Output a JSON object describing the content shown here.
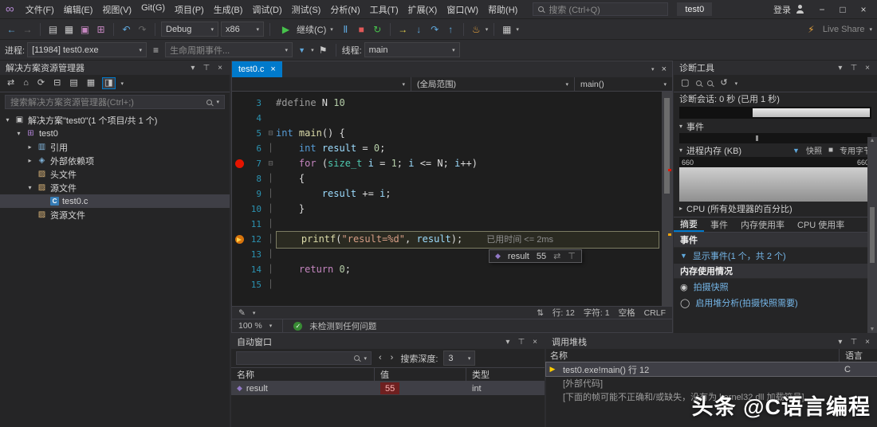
{
  "colors": {
    "accent": "#007acc",
    "breakpoint_red": "#e51400",
    "current_statement_yellow": "#ffd34d",
    "changed_value_red": "#ffb4b4",
    "continue_green": "#47c24c",
    "stop_red": "#e05858",
    "editor_bg": "#1e1e1e",
    "panel_bg": "#252526"
  },
  "icons": {
    "vs_logo": "∞",
    "back": "←",
    "forward": "→",
    "new_file": "▤",
    "open": "▦",
    "save": "▣",
    "save_all": "⊞",
    "undo": "↶",
    "redo": "↷",
    "play": "▶",
    "pause": "Ⅱ",
    "stop": "■",
    "restart": "↻",
    "next_stmt": "→",
    "step_into": "↓",
    "step_over": "↷",
    "step_out": "↑",
    "hot_reload": "♨",
    "chevron": "▾",
    "close": "×",
    "minimize": "−",
    "maximize": "□",
    "pin": "⊤",
    "lightning": "⚡",
    "threads": "≡",
    "funnel": "▼",
    "prev": "‹",
    "next": "›",
    "camera": "◉",
    "circle": "◯",
    "home": "⌂",
    "switch_views": "⇄",
    "refresh": "⟳",
    "collapse_all": "⊟",
    "show_all_files": "▤",
    "properties": "▦",
    "preview": "◨",
    "select_tool": "▢",
    "zoom_reset": "↺",
    "updown": "⇅",
    "diamond": "◆",
    "cur_arrow": "▶",
    "flag": "⚑",
    "check": "✓",
    "broom": "✎",
    "expander_right": "▸"
  },
  "titlebar": {
    "menus": [
      "文件(F)",
      "编辑(E)",
      "视图(V)",
      "Git(G)",
      "项目(P)",
      "生成(B)",
      "调试(D)",
      "测试(S)",
      "分析(N)",
      "工具(T)",
      "扩展(X)",
      "窗口(W)",
      "帮助(H)"
    ],
    "search_placeholder": "搜索 (Ctrl+Q)",
    "solution": "test0",
    "signin": "登录"
  },
  "toolbar1": {
    "config": "Debug",
    "platform": "x86",
    "continue_label": "继续(C)",
    "live_share": "Live Share"
  },
  "toolbar2": {
    "process_label": "进程:",
    "process_value": "[11984] test0.exe",
    "lifecycle": "生命周期事件...",
    "thread_label": "线程:",
    "thread_value": "main"
  },
  "solution_explorer": {
    "title": "解决方案资源管理器",
    "search_placeholder": "搜索解决方案资源管理器(Ctrl+;)",
    "tree": [
      {
        "cls": "lvl0",
        "exp": "▾",
        "icon": "▣",
        "icls": "ic-sol",
        "icon_name": "solution-icon",
        "label": "解决方案\"test0\"(1 个项目/共 1 个)"
      },
      {
        "cls": "lvl1",
        "exp": "▾",
        "icon": "⊞",
        "icls": "ic-proj",
        "icon_name": "project-icon",
        "label": "test0"
      },
      {
        "cls": "lvl2",
        "exp": "▸",
        "icon": "▥",
        "icls": "ic-ref",
        "icon_name": "references-icon",
        "label": "引用"
      },
      {
        "cls": "lvl2",
        "exp": "▸",
        "icon": "◈",
        "icls": "ic-dep",
        "icon_name": "external-dependencies-icon",
        "label": "外部依赖项"
      },
      {
        "cls": "lvl2",
        "exp": "",
        "icon": "▨",
        "icls": "ic-folder",
        "icon_name": "folder-icon",
        "label": "头文件"
      },
      {
        "cls": "lvl2",
        "exp": "▾",
        "icon": "▨",
        "icls": "ic-folder",
        "icon_name": "folder-icon",
        "label": "源文件"
      },
      {
        "cls": "lvl3 sel",
        "exp": "",
        "icon": "C",
        "icls": "ic-cfile",
        "icon_name": "c-file-icon",
        "label": "test0.c"
      },
      {
        "cls": "lvl2",
        "exp": "",
        "icon": "▨",
        "icls": "ic-folder",
        "icon_name": "folder-icon",
        "label": "资源文件"
      }
    ]
  },
  "editor": {
    "tab_label": "test0.c",
    "crumb1": "",
    "crumb2": "(全局范围)",
    "crumb3": "main()",
    "zoom": "100 %",
    "health": "未检测到任何问题",
    "status": {
      "line": "行: 12",
      "col": "字符: 1",
      "spaces": "空格",
      "eol": "CRLF"
    },
    "datatip": {
      "name": "result",
      "value": "55"
    },
    "lines": [
      {
        "n": 3,
        "f": "",
        "tk": [
          {
            "c": "pp",
            "t": "#define"
          },
          {
            "c": "pl",
            "t": " N "
          },
          {
            "c": "num",
            "t": "10"
          }
        ]
      },
      {
        "n": 4,
        "f": "",
        "tk": []
      },
      {
        "n": 5,
        "f": "⊟",
        "tk": [
          {
            "c": "kw",
            "t": "int"
          },
          {
            "c": "pl",
            "t": " "
          },
          {
            "c": "fn",
            "t": "main"
          },
          {
            "c": "pl",
            "t": "() {"
          }
        ]
      },
      {
        "n": 6,
        "f": "│",
        "tk": [
          {
            "c": "pl",
            "t": "    "
          },
          {
            "c": "kw",
            "t": "int"
          },
          {
            "c": "pl",
            "t": " "
          },
          {
            "c": "var",
            "t": "result"
          },
          {
            "c": "pl",
            "t": " = "
          },
          {
            "c": "num",
            "t": "0"
          },
          {
            "c": "pl",
            "t": ";"
          }
        ]
      },
      {
        "n": 7,
        "bp": "red",
        "f": "⊟",
        "tk": [
          {
            "c": "pl",
            "t": "    "
          },
          {
            "c": "ctrl",
            "t": "for"
          },
          {
            "c": "pl",
            "t": " ("
          },
          {
            "c": "type",
            "t": "size_t"
          },
          {
            "c": "pl",
            "t": " "
          },
          {
            "c": "var",
            "t": "i"
          },
          {
            "c": "pl",
            "t": " = "
          },
          {
            "c": "num",
            "t": "1"
          },
          {
            "c": "pl",
            "t": "; "
          },
          {
            "c": "var",
            "t": "i"
          },
          {
            "c": "pl",
            "t": " <= "
          },
          {
            "c": "pl",
            "t": "N"
          },
          {
            "c": "pl",
            "t": "; "
          },
          {
            "c": "var",
            "t": "i"
          },
          {
            "c": "pl",
            "t": "++)"
          }
        ]
      },
      {
        "n": 8,
        "f": "│",
        "tk": [
          {
            "c": "pl",
            "t": "    {"
          }
        ]
      },
      {
        "n": 9,
        "f": "│",
        "tk": [
          {
            "c": "pl",
            "t": "        "
          },
          {
            "c": "var",
            "t": "result"
          },
          {
            "c": "pl",
            "t": " += "
          },
          {
            "c": "var",
            "t": "i"
          },
          {
            "c": "pl",
            "t": ";"
          }
        ]
      },
      {
        "n": 10,
        "f": "│",
        "tk": [
          {
            "c": "pl",
            "t": "    }"
          }
        ]
      },
      {
        "n": 11,
        "f": "│",
        "tk": []
      },
      {
        "n": 12,
        "bp": "cur",
        "f": "│",
        "box": true,
        "perftip": "已用时间 <= 2ms",
        "tk": [
          {
            "c": "pl",
            "t": "    "
          },
          {
            "c": "fn",
            "t": "printf"
          },
          {
            "c": "pl",
            "t": "("
          },
          {
            "c": "str",
            "t": "\"result=%d\""
          },
          {
            "c": "pl",
            "t": ", "
          },
          {
            "c": "var",
            "t": "result"
          },
          {
            "c": "pl",
            "t": ");"
          }
        ]
      },
      {
        "n": 13,
        "f": "│",
        "tk": []
      },
      {
        "n": 14,
        "f": "│",
        "tk": [
          {
            "c": "pl",
            "t": "    "
          },
          {
            "c": "ctrl",
            "t": "return"
          },
          {
            "c": "pl",
            "t": " "
          },
          {
            "c": "num",
            "t": "0"
          },
          {
            "c": "pl",
            "t": ";"
          }
        ]
      },
      {
        "n": 15,
        "f": "│",
        "tk": []
      }
    ]
  },
  "diag": {
    "title": "诊断工具",
    "session": "诊断会话: 0 秒 (已用 1 秒)",
    "events_label": "事件",
    "mem_label": "进程内存 (KB)",
    "legend_snapshot": "快照",
    "legend_private": "专用字节",
    "mem_left": "660",
    "mem_right": "660",
    "cpu_label": "CPU (所有处理器的百分比)",
    "tabs": [
      {
        "label": "摘要",
        "cls": "active"
      },
      {
        "label": "事件",
        "cls": ""
      },
      {
        "label": "内存使用率",
        "cls": ""
      },
      {
        "label": "CPU 使用率",
        "cls": ""
      }
    ],
    "summary": {
      "events_header": "事件",
      "show_events": "显示事件(1 个，共 2 个)",
      "mem_header": "内存使用情况",
      "snapshot": "拍摄快照",
      "heap": "启用堆分析(拍摄快照需要)"
    }
  },
  "watch": {
    "title": "自动窗口",
    "depth_label": "搜索深度:",
    "depth_value": "3",
    "col_name": "名称",
    "col_value": "值",
    "col_type": "类型",
    "rows": [
      {
        "cls": "sel",
        "icon": "◆",
        "name": "result",
        "value": "55",
        "type": "int"
      }
    ]
  },
  "callstack": {
    "title": "调用堆栈",
    "col_name": "名称",
    "col_lang": "语言",
    "rows": [
      {
        "cls": "sel",
        "arrow": "▶",
        "name": "test0.exe!main() 行 12",
        "lang": "C"
      },
      {
        "cls": "dimrow",
        "arrow": "",
        "name": "[外部代码]",
        "lang": ""
      },
      {
        "cls": "dimrow",
        "arrow": "",
        "name": "[下面的帧可能不正确和/或缺失，没有为 kernel32.dll 加载符号]",
        "lang": ""
      }
    ]
  },
  "watermark": "头条 @C语言编程"
}
